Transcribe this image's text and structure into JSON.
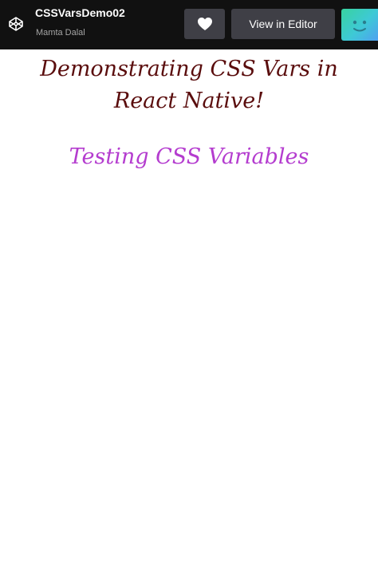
{
  "header": {
    "app_title": "CSSVarsDemo02",
    "author": "Mamta Dalal",
    "view_in_editor_label": "View in Editor",
    "heart_icon": "heart-icon",
    "logo_icon": "codepen-logo-icon",
    "avatar": "user-avatar"
  },
  "main": {
    "heading": "Demonstrating CSS Vars in React Native!",
    "subheading": "Testing CSS Variables"
  },
  "colors": {
    "header_bg": "#111111",
    "button_bg": "#3f3f46",
    "heading_color": "#5a0d0d",
    "subheading_color": "#b43ccf",
    "background": "#ffffff"
  }
}
